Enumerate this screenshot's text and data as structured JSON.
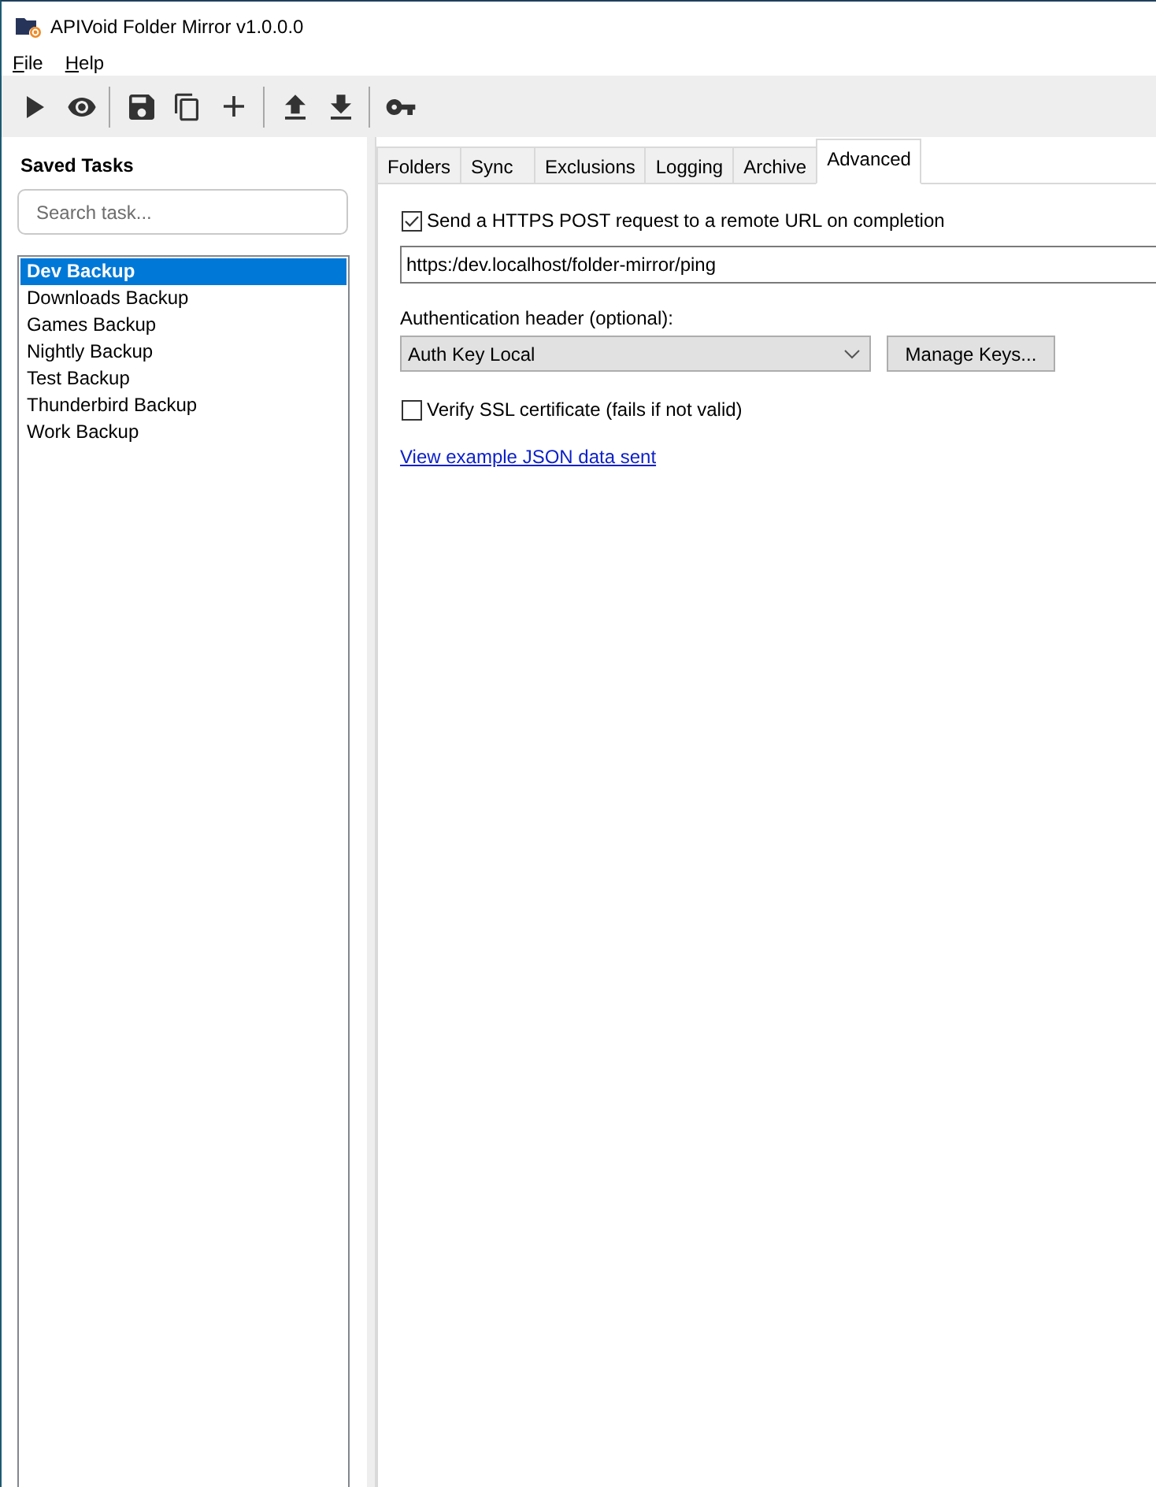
{
  "window": {
    "title": "APIVoid Folder Mirror v1.0.0.0"
  },
  "menu": [
    {
      "label": "File"
    },
    {
      "label": "Help"
    }
  ],
  "sidebar": {
    "title": "Saved Tasks",
    "search": {
      "placeholder": "Search task..."
    },
    "tasks": [
      {
        "label": "Dev Backup",
        "selected": true
      },
      {
        "label": "Downloads Backup",
        "selected": false
      },
      {
        "label": "Games Backup",
        "selected": false
      },
      {
        "label": "Nightly Backup",
        "selected": false
      },
      {
        "label": "Test Backup",
        "selected": false
      },
      {
        "label": "Thunderbird Backup",
        "selected": false
      },
      {
        "label": "Work Backup",
        "selected": false
      }
    ]
  },
  "tabs": [
    {
      "label": "Folders",
      "selected": false
    },
    {
      "label": "Sync",
      "selected": false
    },
    {
      "label": "Exclusions",
      "selected": false
    },
    {
      "label": "Logging",
      "selected": false
    },
    {
      "label": "Archive",
      "selected": false
    },
    {
      "label": "Advanced",
      "selected": true
    }
  ],
  "advanced": {
    "post_request": {
      "label": "Send a HTTPS POST request to a remote URL on completion",
      "checked": true
    },
    "url": {
      "value": "https:/dev.localhost/folder-mirror/ping"
    },
    "auth_header": {
      "label": "Authentication header (optional):",
      "value": "Auth Key Local"
    },
    "manage_keys_button": "Manage Keys...",
    "verify_ssl": {
      "label": "Verify SSL certificate (fails if not valid)",
      "checked": false
    },
    "example_link": "View example JSON data sent"
  }
}
